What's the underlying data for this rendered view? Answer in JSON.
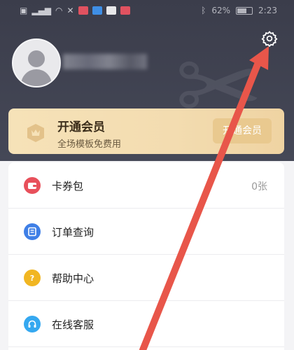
{
  "status_bar": {
    "battery": "62%",
    "time": "2:23",
    "app_icons": [
      "red-app-icon",
      "blue-app-icon",
      "white-app-icon",
      "red-app-icon"
    ]
  },
  "profile": {
    "avatar_icon": "default-avatar-icon",
    "settings_icon": "gear-icon"
  },
  "vip": {
    "title": "开通会员",
    "subtitle": "全场模板免费用",
    "button_label": "开通会员",
    "icon": "crown-shield-icon"
  },
  "menu": {
    "items": [
      {
        "label": "卡券包",
        "value": "0张",
        "icon": "wallet-icon",
        "color": "#e8505b"
      },
      {
        "label": "订单查询",
        "value": "",
        "icon": "receipt-icon",
        "color": "#3f7fe6"
      },
      {
        "label": "帮助中心",
        "value": "",
        "icon": "help-icon",
        "color": "#f1b622"
      },
      {
        "label": "在线客服",
        "value": "",
        "icon": "headset-icon",
        "color": "#35a8f0"
      }
    ]
  },
  "annotation": {
    "arrow_color": "#e8564a"
  }
}
